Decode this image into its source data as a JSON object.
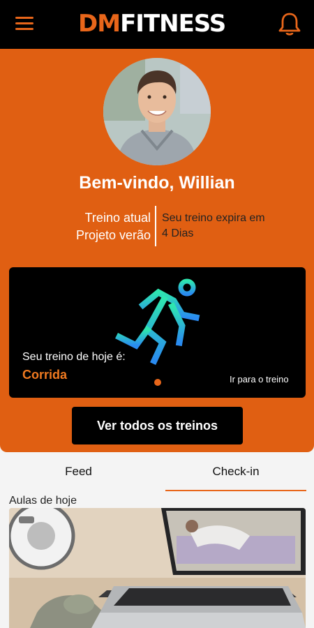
{
  "header": {
    "logo_dm": "DM",
    "logo_fitness": "FITNESS",
    "menu_icon": "hamburger-menu-icon",
    "notification_icon": "bell-icon"
  },
  "profile": {
    "welcome": "Bem-vindo, Willian",
    "current_label": "Treino atual",
    "current_value": "Projeto verão",
    "expiry_text": "Seu treino expira em",
    "expiry_value": "4 Dias"
  },
  "today": {
    "label": "Seu treino de hoje é:",
    "workout": "Corrida",
    "go_link": "Ir para o treino",
    "icon": "runner-icon"
  },
  "actions": {
    "all_workouts": "Ver todos os treinos"
  },
  "tabs": [
    {
      "label": "Feed",
      "active": false
    },
    {
      "label": "Check-in",
      "active": true
    }
  ],
  "classes": {
    "title": "Aulas de hoje"
  },
  "colors": {
    "brand_orange": "#e05f12",
    "black": "#000000",
    "accent_teal": "#2ee6b0",
    "accent_blue": "#2a8bf0"
  }
}
